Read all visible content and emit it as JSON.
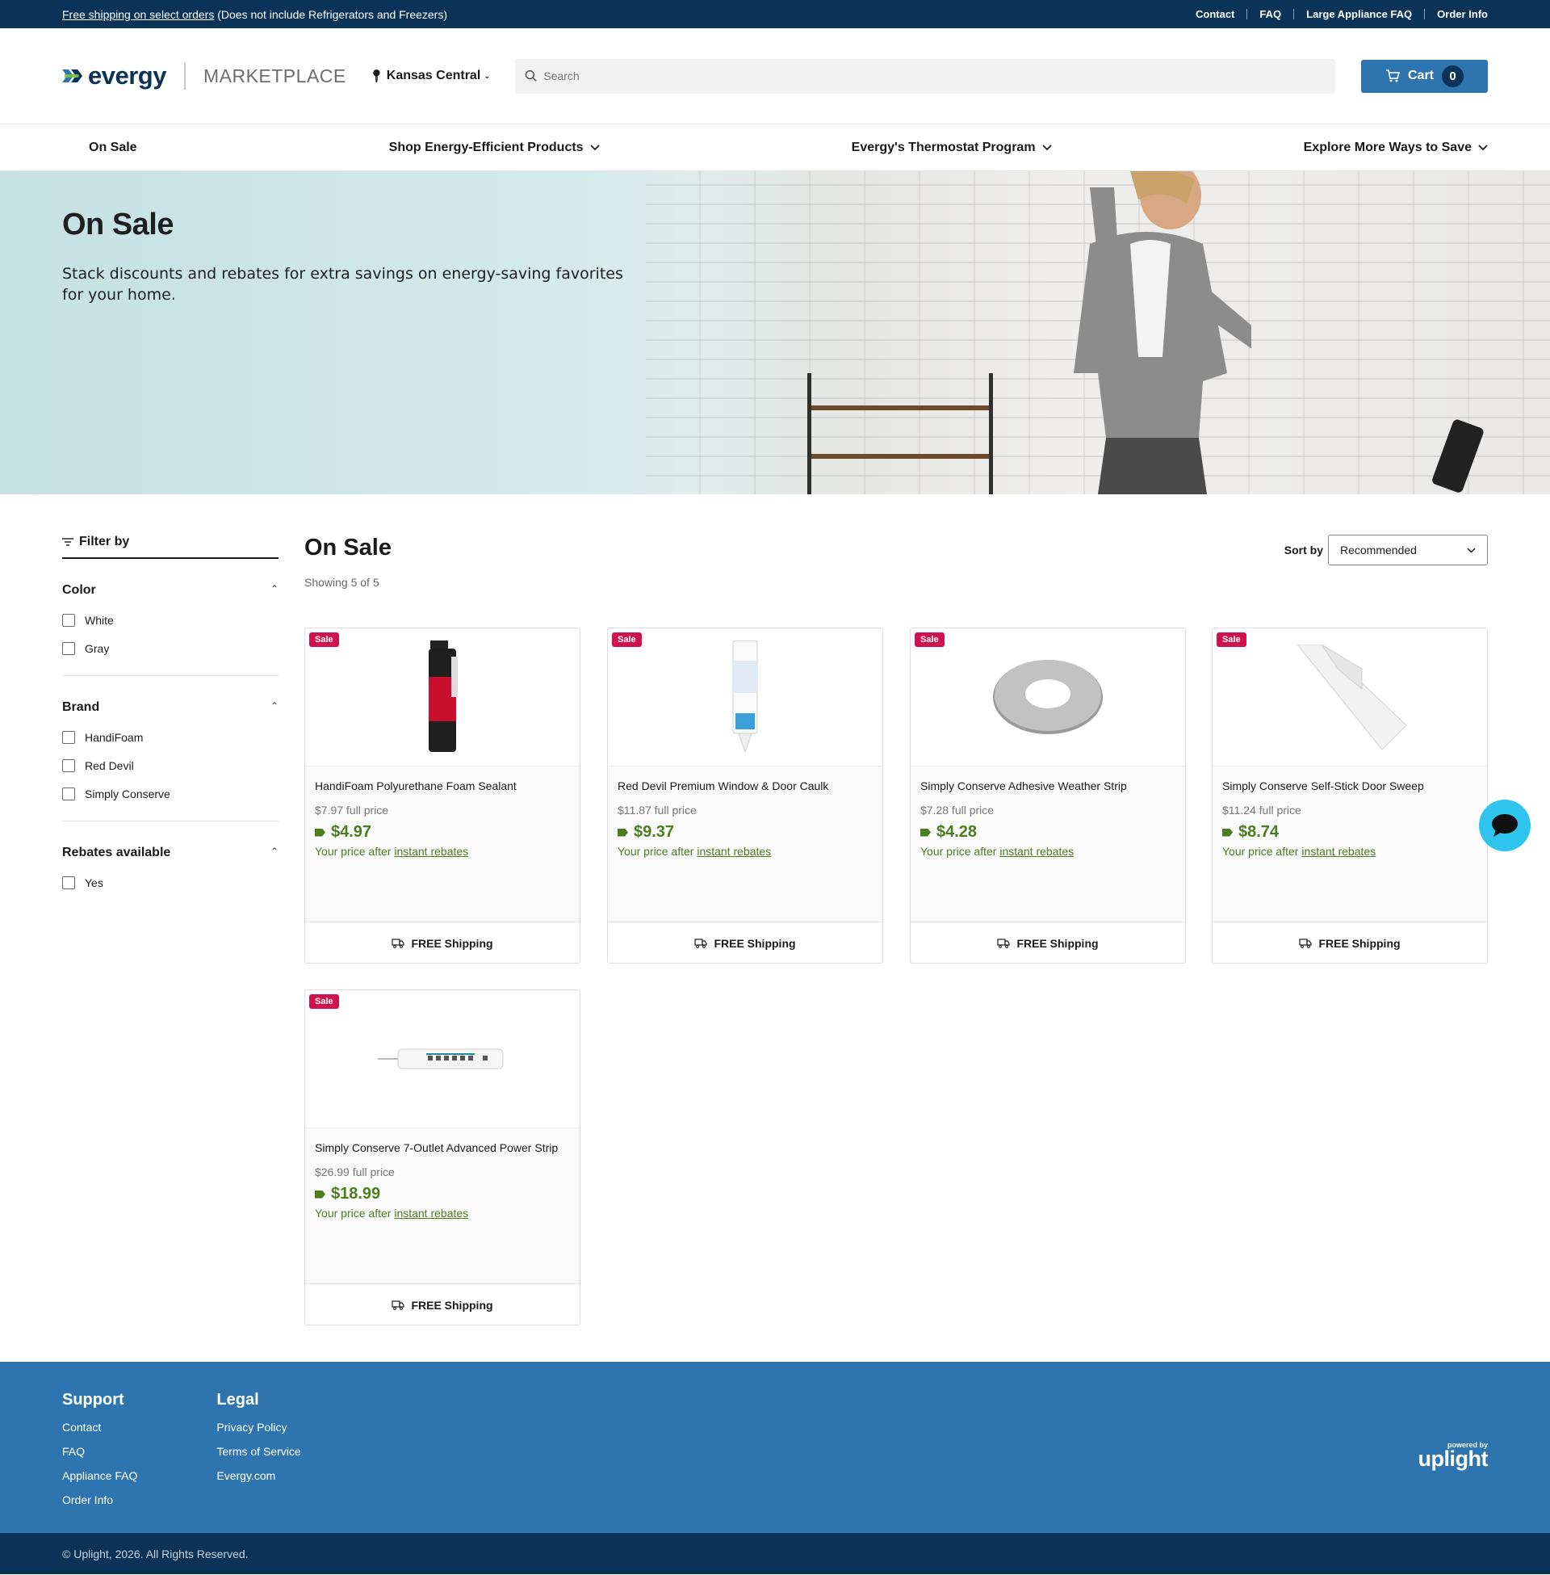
{
  "topbar": {
    "promo_link": "Free shipping on select orders",
    "promo_note": "(Does not include Refrigerators and Freezers)",
    "links": [
      "Contact",
      "FAQ",
      "Large Appliance FAQ",
      "Order Info"
    ]
  },
  "header": {
    "logo": "evergy",
    "marketplace": "MARKETPLACE",
    "location": "Kansas Central",
    "search_placeholder": "Search",
    "cart_label": "Cart",
    "cart_count": "0"
  },
  "nav": [
    "On Sale",
    "Shop Energy-Efficient Products",
    "Evergy's Thermostat Program",
    "Explore More Ways to Save"
  ],
  "hero": {
    "title": "On Sale",
    "subtitle": "Stack discounts and rebates for extra savings on energy-saving favorites for your home."
  },
  "filters": {
    "heading": "Filter by",
    "groups": [
      {
        "title": "Color",
        "options": [
          "White",
          "Gray"
        ]
      },
      {
        "title": "Brand",
        "options": [
          "HandiFoam",
          "Red Devil",
          "Simply Conserve"
        ]
      },
      {
        "title": "Rebates available",
        "options": [
          "Yes"
        ]
      }
    ]
  },
  "listing": {
    "title": "On Sale",
    "showing": "Showing 5 of 5",
    "sort_label": "Sort by",
    "sort_value": "Recommended"
  },
  "products": [
    {
      "badge": "Sale",
      "name": "HandiFoam Polyurethane Foam Sealant",
      "full_price": "$7.97 full price",
      "price": "$4.97",
      "after_prefix": "Your price after",
      "after_link": "instant rebates",
      "shipping": "FREE Shipping"
    },
    {
      "badge": "Sale",
      "name": "Red Devil Premium Window & Door Caulk",
      "full_price": "$11.87 full price",
      "price": "$9.37",
      "after_prefix": "Your price after",
      "after_link": "instant rebates",
      "shipping": "FREE Shipping"
    },
    {
      "badge": "Sale",
      "name": "Simply Conserve Adhesive Weather Strip",
      "full_price": "$7.28 full price",
      "price": "$4.28",
      "after_prefix": "Your price after",
      "after_link": "instant rebates",
      "shipping": "FREE Shipping"
    },
    {
      "badge": "Sale",
      "name": "Simply Conserve Self-Stick Door Sweep",
      "full_price": "$11.24 full price",
      "price": "$8.74",
      "after_prefix": "Your price after",
      "after_link": "instant rebates",
      "shipping": "FREE Shipping"
    },
    {
      "badge": "Sale",
      "name": "Simply Conserve 7-Outlet Advanced Power Strip",
      "full_price": "$26.99 full price",
      "price": "$18.99",
      "after_prefix": "Your price after",
      "after_link": "instant rebates",
      "shipping": "FREE Shipping"
    }
  ],
  "footer": {
    "support_title": "Support",
    "support_links": [
      "Contact",
      "FAQ",
      "Appliance FAQ",
      "Order Info"
    ],
    "legal_title": "Legal",
    "legal_links": [
      "Privacy Policy",
      "Terms of Service",
      "Evergy.com"
    ],
    "powered_by": "powered by",
    "powered_name": "uplight",
    "copyright": "© Uplight, 2026. All Rights Reserved."
  },
  "colors": {
    "navy": "#0a3357",
    "brand_blue": "#2e75b0",
    "sale_badge": "#d0114e",
    "price_green": "#4a7d1f",
    "chat": "#2ec4ee"
  },
  "icons": [
    "location-pin-icon",
    "search-icon",
    "cart-icon",
    "chevron-down-icon",
    "filter-icon",
    "chevron-up-icon",
    "price-tag-icon",
    "truck-icon",
    "chat-icon"
  ]
}
